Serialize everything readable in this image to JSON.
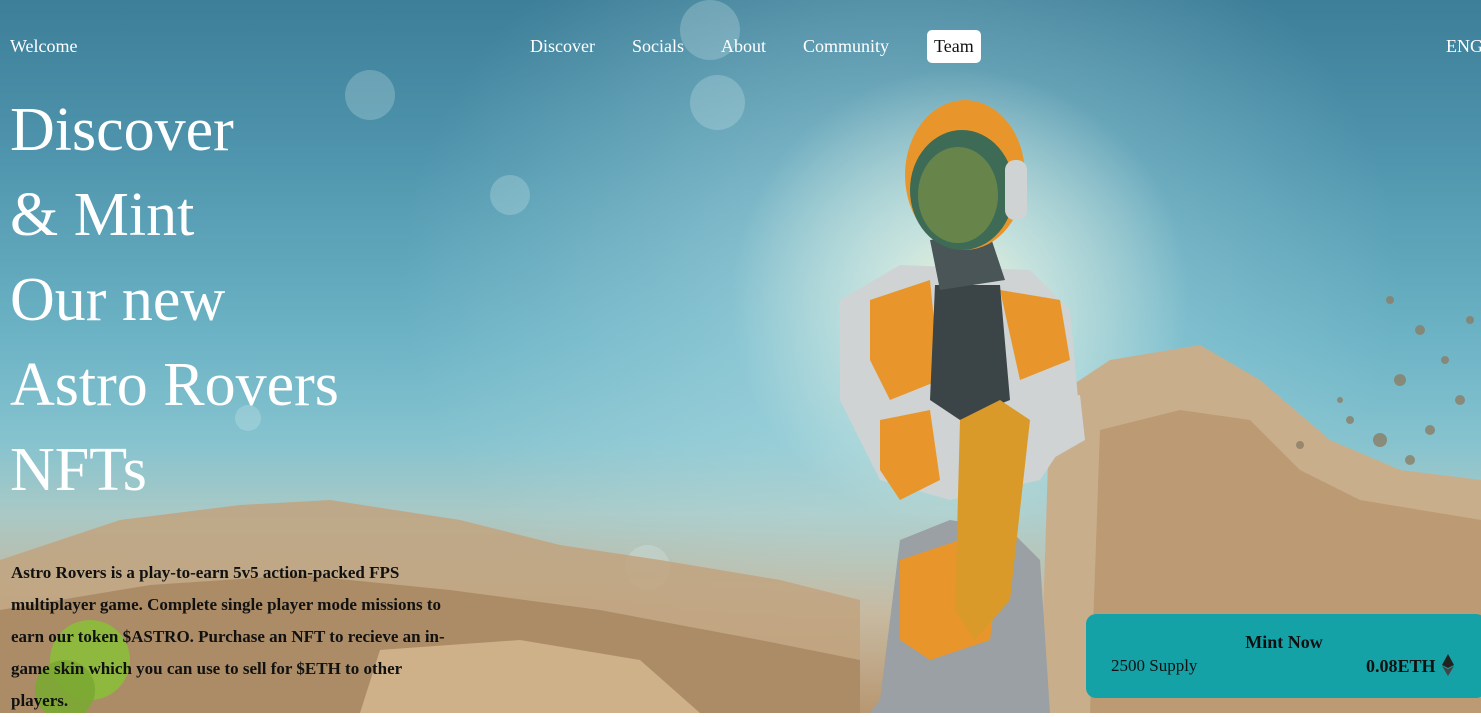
{
  "nav": {
    "welcome": "Welcome",
    "links": [
      "Discover",
      "Socials",
      "About",
      "Community",
      "Team"
    ],
    "active": "Team",
    "lang": "ENG"
  },
  "hero": {
    "lines": [
      "Discover",
      "& Mint",
      "Our new",
      "Astro Rovers",
      "NFTs"
    ]
  },
  "description": "Astro Rovers is a play-to-earn 5v5 action-packed FPS multiplayer game. Complete single player mode missions to earn our token $ASTRO. Purchase an NFT to recieve an in-game skin which you can use to sell for $ETH to other players.",
  "mint": {
    "title": "Mint Now",
    "supply": "2500 Supply",
    "price": "0.08ETH",
    "price_icon": "ethereum-icon"
  },
  "colors": {
    "mint_card": "#14a2a6",
    "accent_orange": "#e8962c"
  }
}
